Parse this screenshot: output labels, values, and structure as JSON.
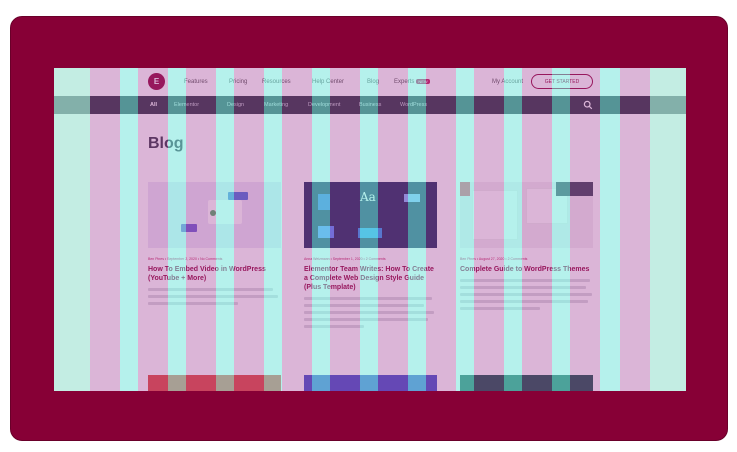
{
  "nav": {
    "logo": "E",
    "items": [
      "Features",
      "Pricing",
      "Resources",
      "Help Center",
      "Blog",
      "Experts"
    ],
    "experts_badge": "NEW",
    "account": "My Account",
    "cta": "GET STARTED"
  },
  "categories": [
    "All",
    "Elementor",
    "Design",
    "Marketing",
    "Development",
    "Business",
    "WordPress"
  ],
  "page_title": "Blog",
  "posts": [
    {
      "meta": "Ben Pines • September 2, 2020 • No Comments",
      "title": "How To Embed Video in WordPress (YouTube + More)"
    },
    {
      "meta": "Anna Weizmann • September 1, 2020 • 2 Comments",
      "title": "Elementor Team Writes: How To Create a Complete Web Design Style Guide (Plus Template)"
    },
    {
      "meta": "Ben Pines • August 27, 2020 • 2 Comments",
      "title": "Complete Guide to WordPress Themes"
    }
  ],
  "colors": {
    "frame": "#870036",
    "brand": "#92003b",
    "catbar": "#2a3240",
    "overlay_cyan": "#78e6dc",
    "overlay_purple": "#a03c96"
  }
}
